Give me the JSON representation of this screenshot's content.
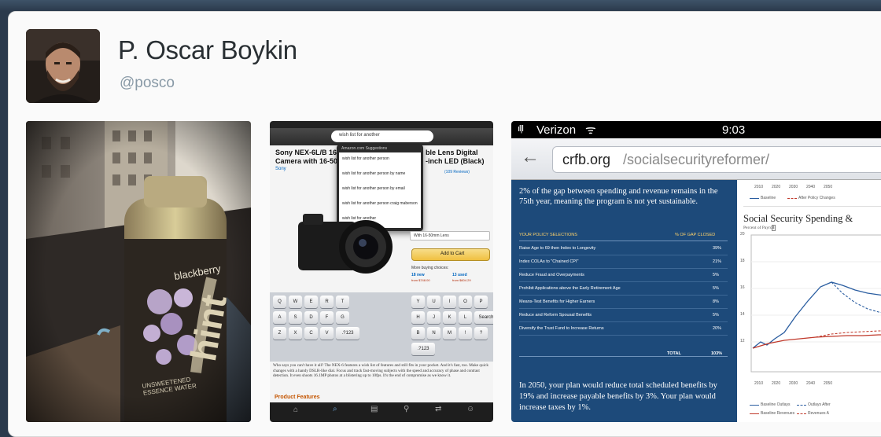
{
  "profile": {
    "name": "P. Oscar Boykin",
    "handle": "@posco"
  },
  "photo1": {
    "bottle_label": "blackberry",
    "brand": "hint",
    "subtitle": "UNSWEETENED ESSENCE WATER"
  },
  "photo2": {
    "search_query": "wish list for another",
    "product_title_left": "Sony NEX-6L/B 16",
    "product_title_left2": "Camera with 16-50",
    "product_title_right": "ble Lens Digital",
    "product_title_right2": "-inch LED (Black)",
    "brand": "Sony",
    "suggestion_header": "Amazon.com Suggestions",
    "suggestions": [
      "wish list for another person",
      "wish list for another person by name",
      "wish list for another person by email",
      "wish list for another person craig maberson",
      "wish list for another"
    ],
    "add_to_cart": "Add to Cart",
    "reviews": "(109 Reviews)",
    "more_buying": "More buying choices:",
    "new_label": "18 new",
    "used_label": "13 used",
    "new_price": "from $748.00",
    "used_price": "from $604.29",
    "kit_select": "With 16-50mm Lens",
    "description": "Who says you can't have it all? The NEX-6 features a wish list of features and still fits in your pocket. And it's fast, too. Make quick changes with a handy DSLR-like dial. Focus and track fast-moving subjects with the speed and accuracy of phase and contrast detection. It even shoots 16.1MP photos at a blistering up to 10fps. It's the end of compromise as we know it.",
    "features_heading": "Product Features",
    "keys_left": [
      "Q",
      "W",
      "E",
      "R",
      "T",
      "A",
      "S",
      "D",
      "F",
      "G",
      "Z",
      "X",
      "C",
      "V",
      ".?123"
    ],
    "keys_right": [
      "Y",
      "U",
      "I",
      "O",
      "P",
      "H",
      "J",
      "K",
      "L",
      "Search",
      "B",
      "N",
      "M",
      "!",
      "?",
      ".?123"
    ]
  },
  "photo3": {
    "carrier": "Verizon",
    "time": "9:03",
    "url_domain": "crfb.org",
    "url_path": "/socialsecurityreformer/",
    "intro": "2% of the gap between spending and revenue remains in the 75th year, meaning the program is not yet sustainable.",
    "table_header_left": "YOUR POLICY SELECTIONS",
    "table_header_right": "% OF GAP CLOSED",
    "rows": [
      {
        "label": "Raise Age to 69 then Index to Longevity",
        "value": "39%"
      },
      {
        "label": "Index COLAs to \"Chained CPI\"",
        "value": "21%"
      },
      {
        "label": "Reduce Fraud and Overpayments",
        "value": "5%"
      },
      {
        "label": "Prohibit Applications above the Early Retirement Age",
        "value": "5%"
      },
      {
        "label": "Means-Test Benefits for Higher Earners",
        "value": "8%"
      },
      {
        "label": "Reduce and Reform Spousal Benefits",
        "value": "5%"
      },
      {
        "label": "Diversify the Trust Fund to Increase Returns",
        "value": "20%"
      }
    ],
    "total_label": "TOTAL",
    "total_value": "103%",
    "summary": "In 2050, your plan would reduce total scheduled benefits by 19% and increase payable benefits by 3%. Your plan would increase taxes by 1%.",
    "chart_title": "Social Security Spending &",
    "chart_subtitle": "Percent of Payroll",
    "top_years": [
      "2010",
      "2020",
      "2030",
      "2040",
      "2050"
    ],
    "top_legend_baseline": "Baseline",
    "top_legend_after": "After Policy Changes",
    "bottom_years": [
      "2010",
      "2020",
      "2030",
      "2040",
      "2050"
    ],
    "y_ticks": [
      "20",
      "18",
      "16",
      "14",
      "12"
    ],
    "legend_a": "Baseline Outlays",
    "legend_b": "Outlays After",
    "legend_c": "Baseline Revenues",
    "legend_d": "Revenues A"
  },
  "colors": {
    "background": "#2b3a4c",
    "card": "#fafafa",
    "crfb_blue": "#1d4a7a",
    "amazon_orange": "#f0c040"
  }
}
